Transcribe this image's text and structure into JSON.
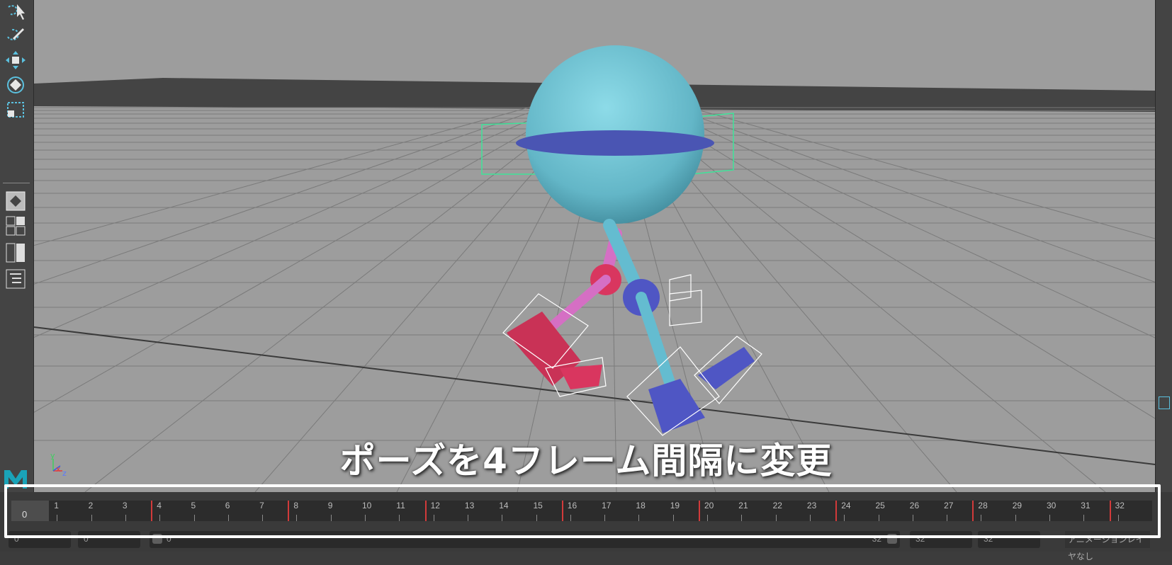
{
  "viewport": {
    "caption": "ポーズを4フレーム間隔に変更",
    "axis": {
      "x": "x",
      "y": "y",
      "z": "z"
    },
    "colors": {
      "floor": "#9d9d9d",
      "background_wall": "#444444",
      "body": "#6cc3d4",
      "belt": "#4a55b3",
      "leg_pink": "#d9367b",
      "foot_blue": "#4f56c4",
      "selection_green": "#3fe39a"
    }
  },
  "toolbar": {
    "tools": [
      "lasso-select-icon",
      "select-arrow-icon",
      "paint-select-icon",
      "move-tool-icon",
      "rotate-tool-icon",
      "scale-tool-icon"
    ],
    "layouts": [
      "single-view-layout-icon",
      "four-view-layout-icon",
      "two-view-layout-icon",
      "outliner-icon"
    ]
  },
  "timeline": {
    "current_frame": "0",
    "ticks": [
      "0",
      "1",
      "2",
      "3",
      "4",
      "5",
      "6",
      "7",
      "8",
      "9",
      "10",
      "11",
      "12",
      "13",
      "14",
      "15",
      "16",
      "17",
      "18",
      "19",
      "20",
      "21",
      "22",
      "23",
      "24",
      "25",
      "26",
      "27",
      "28",
      "29",
      "30",
      "31",
      "32"
    ],
    "keyframes": [
      0,
      4,
      8,
      12,
      16,
      20,
      24,
      28,
      32
    ],
    "start_frame": "0",
    "playback_start": "0",
    "slider_start": "0",
    "slider_end": "32",
    "playback_end": "32",
    "end_frame": "32",
    "anim_layer": "アニメーションレイヤなし"
  }
}
